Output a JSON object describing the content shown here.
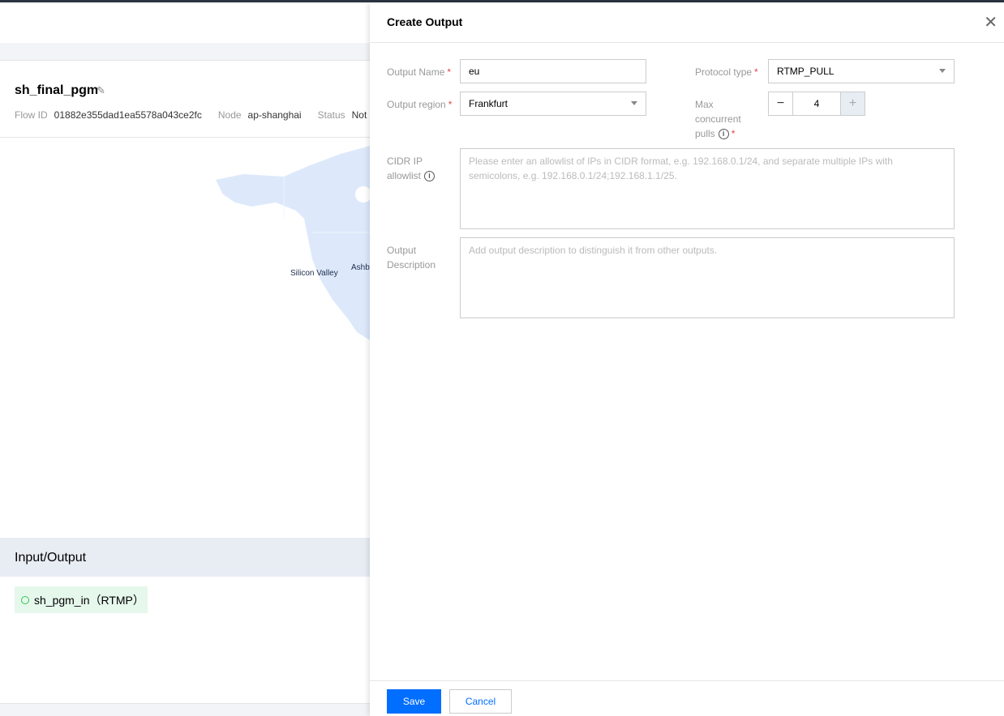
{
  "flow": {
    "title": "sh_final_pgm",
    "flow_id_label": "Flow ID",
    "flow_id": "01882e355dad1ea5578a043ce2fc",
    "node_label": "Node",
    "node": "ap-shanghai",
    "status_label": "Status",
    "status": "Not s"
  },
  "map": {
    "labels": [
      "Silicon Valley",
      "Ashb"
    ]
  },
  "io": {
    "title": "Input/Output",
    "items": [
      {
        "label": "sh_pgm_in（RTMP）"
      }
    ]
  },
  "drawer": {
    "title": "Create Output",
    "output_name": {
      "label": "Output Name",
      "value": "eu"
    },
    "protocol": {
      "label": "Protocol type",
      "value": "RTMP_PULL"
    },
    "region": {
      "label": "Output region",
      "value": "Frankfurt"
    },
    "max_pulls": {
      "label_1": "Max",
      "label_2": "concurrent",
      "label_3": "pulls",
      "value": "4"
    },
    "cidr": {
      "label_1": "CIDR IP",
      "label_2": "allowlist",
      "placeholder": "Please enter an allowlist of IPs in CIDR format, e.g. 192.168.0.1/24, and separate multiple IPs with semicolons, e.g. 192.168.0.1/24;192.168.1.1/25."
    },
    "description": {
      "label_1": "Output",
      "label_2": "Description",
      "placeholder": "Add output description to distinguish it from other outputs."
    },
    "save_label": "Save",
    "cancel_label": "Cancel"
  },
  "colors": {
    "primary": "#006eff",
    "map_land": "#dde9fb",
    "required": "#e54545"
  }
}
